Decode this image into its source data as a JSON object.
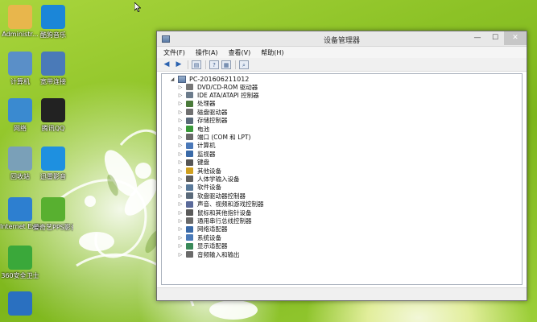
{
  "desktop_icons": [
    {
      "label": "Administr...",
      "icon": "folder-icon",
      "color": "#e8b64c"
    },
    {
      "label": "酷狗音乐",
      "icon": "kugou-icon",
      "color": "#1b86d8"
    },
    {
      "label": "计算机",
      "icon": "computer-icon",
      "color": "#5a8fc8"
    },
    {
      "label": "宽带连接",
      "icon": "network-connection-icon",
      "color": "#4a7ab8"
    },
    {
      "label": "网络",
      "icon": "network-icon",
      "color": "#3a8ad0"
    },
    {
      "label": "腾讯QQ",
      "icon": "qq-icon",
      "color": "#222222"
    },
    {
      "label": "回收站",
      "icon": "recycle-bin-icon",
      "color": "#7aa0b8"
    },
    {
      "label": "迅雷影音",
      "icon": "xunlei-icon",
      "color": "#1e90e0"
    },
    {
      "label": "Internet Explorer",
      "icon": "ie-icon",
      "color": "#2d7fd0"
    },
    {
      "label": "爱奇艺PPS影音",
      "icon": "iqiyi-pps-icon",
      "color": "#58b030"
    },
    {
      "label": "360安全卫士",
      "icon": "360-icon",
      "color": "#3aa83a"
    },
    {
      "label": "",
      "icon": "search-app-icon",
      "color": "#2a70c0"
    }
  ],
  "window": {
    "title": "设备管理器",
    "controls": {
      "minimize": "—",
      "maximize": "☐",
      "close": "✕"
    },
    "menu": [
      "文件(F)",
      "操作(A)",
      "查看(V)",
      "帮助(H)"
    ],
    "root": "PC-201606211012",
    "devices": [
      {
        "label": "DVD/CD-ROM 驱动器",
        "icon": "dvd-icon",
        "color": "#777777"
      },
      {
        "label": "IDE ATA/ATAPI 控制器",
        "icon": "ide-controller-icon",
        "color": "#6b7b8b"
      },
      {
        "label": "处理器",
        "icon": "processor-icon",
        "color": "#4a7a3a"
      },
      {
        "label": "磁盘驱动器",
        "icon": "disk-drive-icon",
        "color": "#707070"
      },
      {
        "label": "存储控制器",
        "icon": "storage-controller-icon",
        "color": "#5a6a7a"
      },
      {
        "label": "电池",
        "icon": "battery-icon",
        "color": "#3a9a3a"
      },
      {
        "label": "端口 (COM 和 LPT)",
        "icon": "port-icon",
        "color": "#6a6a6a"
      },
      {
        "label": "计算机",
        "icon": "computer-icon",
        "color": "#4a78b8"
      },
      {
        "label": "监视器",
        "icon": "monitor-icon",
        "color": "#3a6aa8"
      },
      {
        "label": "键盘",
        "icon": "keyboard-icon",
        "color": "#555555"
      },
      {
        "label": "其他设备",
        "icon": "other-devices-icon",
        "color": "#d0a020"
      },
      {
        "label": "人体学输入设备",
        "icon": "hid-icon",
        "color": "#606060"
      },
      {
        "label": "软件设备",
        "icon": "software-device-icon",
        "color": "#5a7a9a"
      },
      {
        "label": "软盘驱动器控制器",
        "icon": "floppy-controller-icon",
        "color": "#5a6a7a"
      },
      {
        "label": "声音、视频和游戏控制器",
        "icon": "sound-icon",
        "color": "#5a6a9a"
      },
      {
        "label": "鼠标和其他指针设备",
        "icon": "mouse-icon",
        "color": "#5a5a5a"
      },
      {
        "label": "通用串行总线控制器",
        "icon": "usb-icon",
        "color": "#6a6a6a"
      },
      {
        "label": "网络适配器",
        "icon": "network-adapter-icon",
        "color": "#3a6aa8"
      },
      {
        "label": "系统设备",
        "icon": "system-device-icon",
        "color": "#4a7ab8"
      },
      {
        "label": "显示适配器",
        "icon": "display-adapter-icon",
        "color": "#3a8a5a"
      },
      {
        "label": "音频输入和输出",
        "icon": "audio-io-icon",
        "color": "#6a6a6a"
      }
    ]
  }
}
